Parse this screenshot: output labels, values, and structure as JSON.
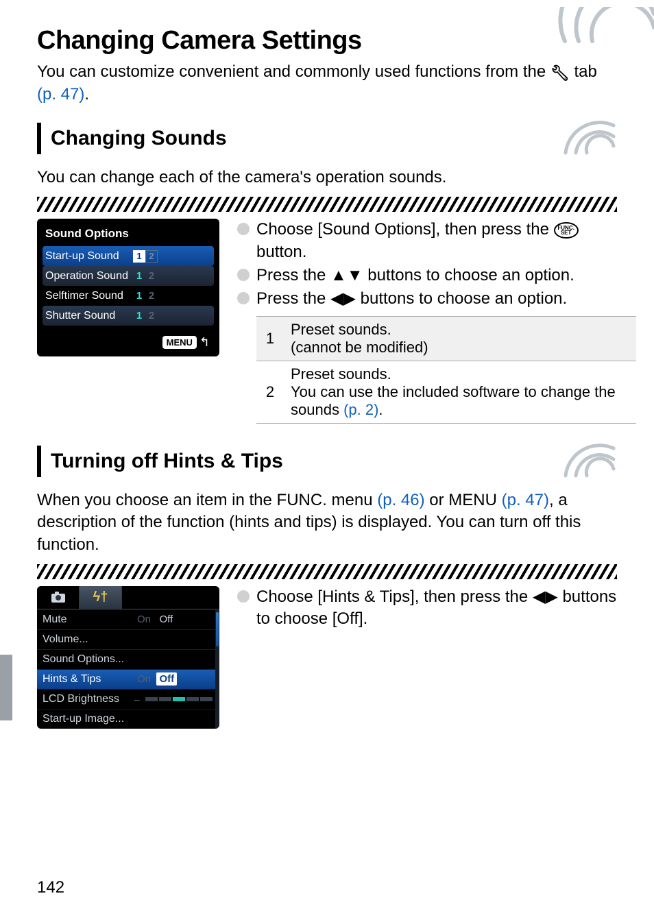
{
  "page_number": "142",
  "h1": "Changing Camera Settings",
  "intro_parts": {
    "pre": "You can customize convenient and commonly used functions from the ",
    "post": " tab ",
    "link": "(p. 47)",
    "dot": "."
  },
  "section1": {
    "heading": "Changing Sounds",
    "body": "You can change each of the camera's operation sounds.",
    "lcd_title": "Sound Options",
    "lcd_rows": [
      {
        "label": "Start-up Sound",
        "opt1": "1",
        "opt2": "2",
        "sel": true
      },
      {
        "label": "Operation Sound",
        "opt1": "1",
        "opt2": "2",
        "sel": false
      },
      {
        "label": "Selftimer Sound",
        "opt1": "1",
        "opt2": "2",
        "sel": false
      },
      {
        "label": "Shutter Sound",
        "opt1": "1",
        "opt2": "2",
        "sel": false
      }
    ],
    "menu_label": "MENU",
    "steps": {
      "s1a": "Choose [Sound Options], then press the ",
      "s1b": " button.",
      "s2": "Press the ▲▼ buttons to choose an option.",
      "s3": "Press the ◀▶ buttons to choose an option."
    },
    "func_label": "FUNC.\nSET",
    "table": {
      "r1n": "1",
      "r1a": "Preset sounds.",
      "r1b": "(cannot be modified)",
      "r2n": "2",
      "r2a": "Preset sounds.",
      "r2b_pre": "You can use the included software to change the sounds ",
      "r2b_link": "(p. 2)",
      "r2b_dot": "."
    }
  },
  "section2": {
    "heading": "Turning off Hints & Tips",
    "body_parts": {
      "a": "When you choose an item in the FUNC. menu ",
      "l1": "(p. 46)",
      "b": " or MENU ",
      "l2": "(p. 47)",
      "c": ", a description of the function (hints and tips) is displayed. You can turn off this function."
    },
    "lcd_rows": {
      "mute": "Mute",
      "mute_on": "On",
      "mute_off": "Off",
      "volume": "Volume...",
      "soundopt": "Sound Options...",
      "hints": "Hints & Tips",
      "hints_on": "On",
      "hints_off": "Off",
      "lcd": "LCD Brightness",
      "startup": "Start-up Image..."
    },
    "step": "Choose [Hints & Tips], then press the ◀▶ buttons to choose [Off]."
  }
}
